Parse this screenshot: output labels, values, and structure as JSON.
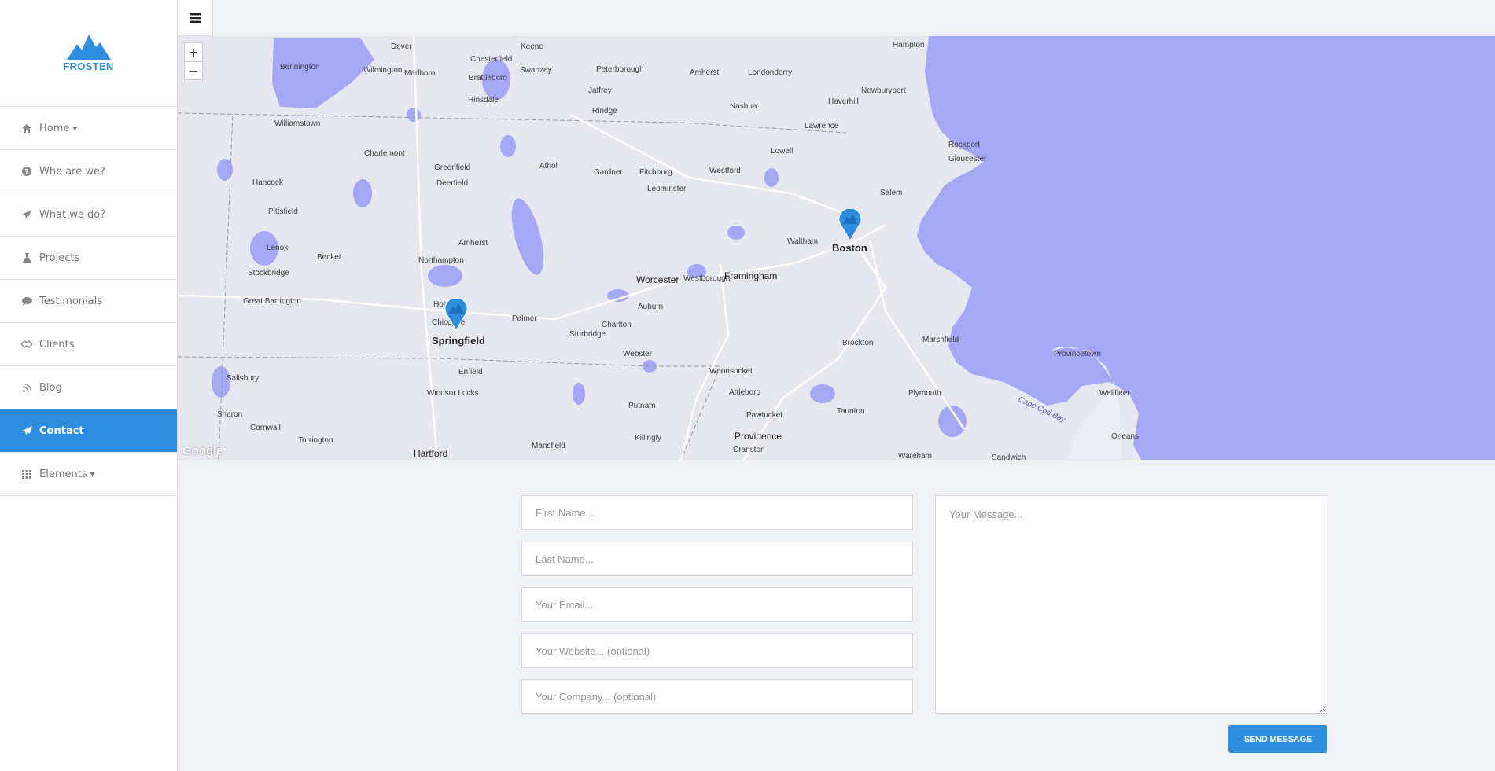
{
  "brand": {
    "name": "FROSTEN",
    "color": "#2d8ddf"
  },
  "nav": {
    "items": [
      {
        "label": "Home",
        "icon": "home-icon",
        "dropdown": true
      },
      {
        "label": "Who are we?",
        "icon": "question-circle-icon"
      },
      {
        "label": "What we do?",
        "icon": "rocket-icon"
      },
      {
        "label": "Projects",
        "icon": "flask-icon"
      },
      {
        "label": "Testimonials",
        "icon": "comment-icon"
      },
      {
        "label": "Clients",
        "icon": "handshake-icon"
      },
      {
        "label": "Blog",
        "icon": "rss-icon"
      },
      {
        "label": "Contact",
        "icon": "paper-plane-icon",
        "active": true
      },
      {
        "label": "Elements",
        "icon": "grid-icon",
        "dropdown": true
      }
    ]
  },
  "map": {
    "zoom_in": "+",
    "zoom_out": "−",
    "attribution": "Google",
    "markers": [
      "Boston",
      "Springfield"
    ],
    "places": [
      "Dover",
      "Keene",
      "Hampton",
      "Bennington",
      "Chesterfield",
      "Wilmington",
      "Marlboro",
      "Swanzey",
      "Peterborough",
      "Amherst",
      "Londonderry",
      "Brattleboro",
      "Newburyport",
      "Hinsdale",
      "Jaffrey",
      "Haverhill",
      "Williamstown",
      "Rindge",
      "Nashua",
      "Lawrence",
      "Charlemont",
      "Rockport",
      "Lowell",
      "Gloucester",
      "Greenfield",
      "Athol",
      "Gardner",
      "Fitchburg",
      "Westford",
      "Hancock",
      "Deerfield",
      "Leominster",
      "Salem",
      "Pittsfield",
      "Amherst",
      "Waltham",
      "Boston",
      "Lenox",
      "Becket",
      "Northampton",
      "Stockbridge",
      "Worcester",
      "Westborough",
      "Framingham",
      "Great Barrington",
      "Holyoke",
      "Chicopee",
      "Springfield",
      "Palmer",
      "Auburn",
      "Charlton",
      "Sturbridge",
      "Brockton",
      "Marshfield",
      "Provincetown",
      "Salisbury",
      "Webster",
      "Woonsocket",
      "Windsor Locks",
      "Enfield",
      "Attleboro",
      "Plymouth",
      "Wellfleet",
      "Sharon",
      "Putnam",
      "Pawtucket",
      "Taunton",
      "Cape Cod Bay",
      "Cornwall",
      "Torrington",
      "Killingly",
      "Providence",
      "Orleans",
      "Hartford",
      "Mansfield",
      "Cranston",
      "Wareham",
      "Sandwich"
    ]
  },
  "form": {
    "first_name_placeholder": "First Name...",
    "last_name_placeholder": "Last Name...",
    "email_placeholder": "Your Email...",
    "website_placeholder": "Your Website... (optional)",
    "company_placeholder": "Your Company... (optional)",
    "message_placeholder": "Your Message...",
    "send_label": "SEND MESSAGE"
  },
  "colors": {
    "accent": "#2d8ddf",
    "water": "#a5a8f6",
    "land": "#e6e7ef"
  }
}
